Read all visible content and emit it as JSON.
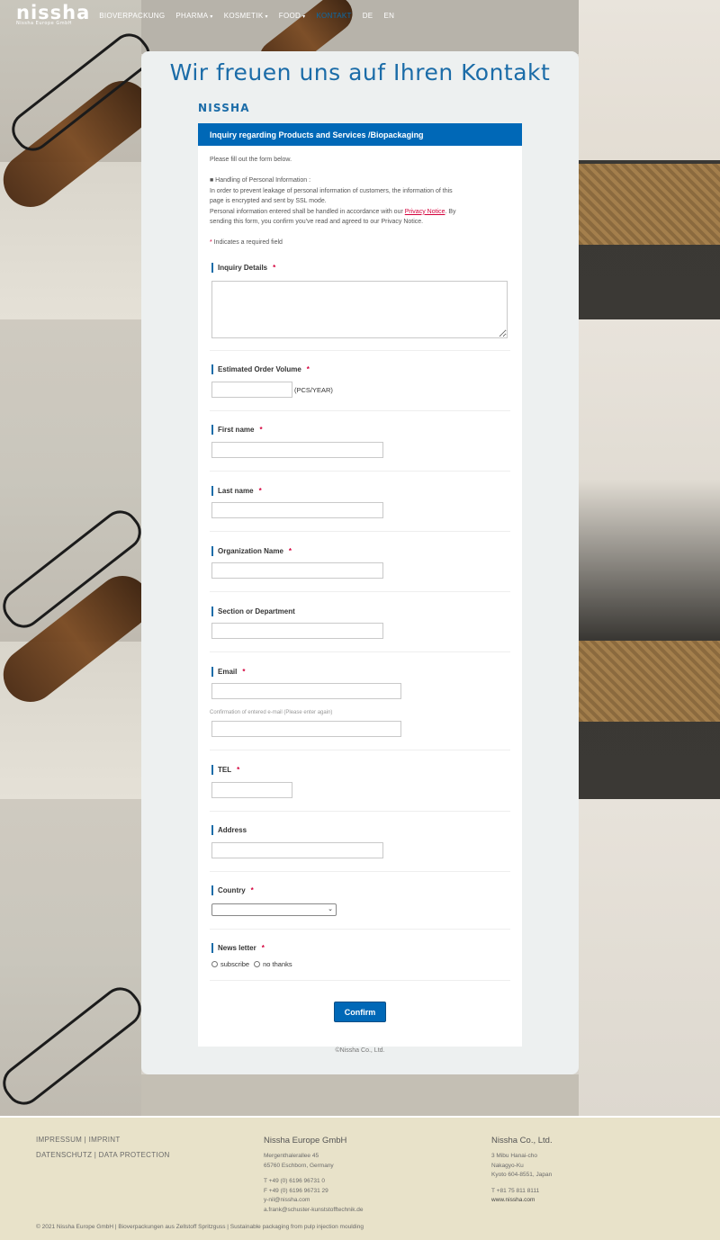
{
  "nav": {
    "logo": "nissha",
    "logo_sub": "Nissha Europe GmbH",
    "items": [
      {
        "label": "BIOVERPACKUNG",
        "dropdown": false
      },
      {
        "label": "PHARMA",
        "dropdown": true
      },
      {
        "label": "KOSMETIK",
        "dropdown": true
      },
      {
        "label": "FOOD",
        "dropdown": true
      },
      {
        "label": "KONTAKT",
        "dropdown": false,
        "active": true
      },
      {
        "label": "DE",
        "dropdown": false
      },
      {
        "label": "EN",
        "dropdown": false
      }
    ],
    "caret_icon": "chevron-down-icon"
  },
  "page": {
    "title": "Wir freuen uns auf Ihren Kontakt",
    "brand": "NISSHA"
  },
  "form": {
    "header": "Inquiry regarding Products and Services /Biopackaging",
    "intro_1": "Please fill out the form below.",
    "privacy_heading": "■ Handling of Personal Information :",
    "privacy_text_1": "In order to prevent leakage of personal information of customers, the information of this",
    "privacy_text_2": "page is encrypted and sent by SSL mode.",
    "privacy_text_3_pre": "Personal information entered shall be handled in accordance with our ",
    "privacy_link": "Privacy Notice",
    "privacy_text_3_post": ". By",
    "privacy_text_4": "sending this form, you confirm you've read and agreed to our Privacy Notice.",
    "required_star": "*",
    "required_note": " Indicates a required field",
    "fields": {
      "inquiry": {
        "label": "Inquiry Details",
        "required": true,
        "value": ""
      },
      "volume": {
        "label": "Estimated Order Volume",
        "required": true,
        "value": "",
        "unit": "(PCS/YEAR)"
      },
      "first_name": {
        "label": "First name",
        "required": true,
        "value": ""
      },
      "last_name": {
        "label": "Last name",
        "required": true,
        "value": ""
      },
      "organization": {
        "label": "Organization Name",
        "required": true,
        "value": ""
      },
      "section": {
        "label": "Section or Department",
        "required": false,
        "value": ""
      },
      "email": {
        "label": "Email",
        "required": true,
        "value": "",
        "confirm_hint": "Confirmation of entered e-mail (Please enter again)"
      },
      "tel": {
        "label": "TEL",
        "required": true,
        "value": ""
      },
      "address": {
        "label": "Address",
        "required": false,
        "value": ""
      },
      "country": {
        "label": "Country",
        "required": true,
        "selected": ""
      },
      "newsletter": {
        "label": "News letter",
        "required": true,
        "options": [
          "subscribe",
          "no thanks"
        ]
      }
    },
    "confirm_label": "Confirm",
    "copyright": "©Nissha Co., Ltd."
  },
  "footer": {
    "links": [
      "IMPRESSUM | IMPRINT",
      "DATENSCHUTZ | DATA PROTECTION"
    ],
    "europe": {
      "title": "Nissha Europe GmbH",
      "address": [
        "Mergenthalerallee 45",
        "65760 Eschborn, Germany"
      ],
      "contact": [
        "T +49 (0) 6196 96731 0",
        "F +49 (0) 6196 96731 29",
        "y-nil@nissha.com",
        "a.frank@schuster-kunststofftechnik.de"
      ]
    },
    "japan": {
      "title": "Nissha Co., Ltd.",
      "address": [
        "3 Mibu Hanai-cho",
        "Nakagyo-Ku",
        "Kyoto 604-8551, Japan"
      ],
      "contact": [
        "T +81 75 811 8111",
        "www.nissha.com"
      ]
    },
    "bottom": "© 2021 Nissha Europe GmbH  |  Bioverpackungen aus Zellstoff Spritzguss  |  Sustainable packaging from pulp injection moulding"
  }
}
